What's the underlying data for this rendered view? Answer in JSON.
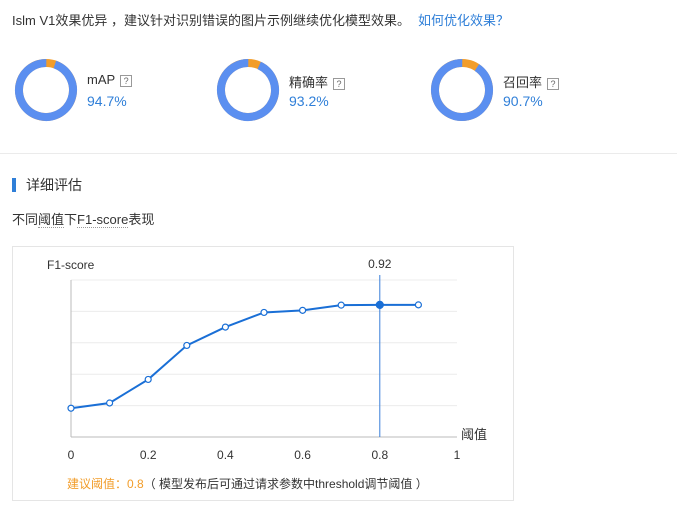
{
  "header": {
    "text": "Islm V1效果优异 ，建议针对识别错误的图片示例继续优化模型效果。",
    "link": "如何优化效果？"
  },
  "metrics": [
    {
      "name": "mAP",
      "value_text": "94.7%",
      "value": 0.947
    },
    {
      "name": "精确率",
      "value_text": "93.2%",
      "value": 0.932
    },
    {
      "name": "召回率",
      "value_text": "90.7%",
      "value": 0.907
    }
  ],
  "help_mark": "?",
  "colors": {
    "ring_main": "#5b8ff0",
    "ring_rest": "#f29d2a",
    "accent": "#2f7fd8",
    "orange": "#f29d2a",
    "line": "#1a6fd6"
  },
  "section": {
    "title": "详细评估"
  },
  "chart_subtitle": {
    "prefix": "不同",
    "mid1": "阈值",
    "mid2": "下",
    "mid3": "F1-score",
    "suffix": "表现"
  },
  "chart_data": {
    "type": "line",
    "ylabel": "F1-score",
    "xlabel": "阈值",
    "x_ticks": [
      "0",
      "0.2",
      "0.4",
      "0.6",
      "0.8",
      "1"
    ],
    "xlim": [
      0,
      1
    ],
    "ylim": [
      0.4,
      1.0
    ],
    "grid": true,
    "x": [
      0,
      0.1,
      0.2,
      0.3,
      0.4,
      0.5,
      0.6,
      0.7,
      0.8,
      0.9
    ],
    "y": [
      0.51,
      0.53,
      0.62,
      0.75,
      0.82,
      0.876,
      0.884,
      0.904,
      0.905,
      0.905
    ],
    "highlight": {
      "x": 0.8,
      "label": "0.92"
    }
  },
  "suggestion": {
    "label": "建议阈值：0.8",
    "note": "（ 模型发布后可通过请求参数中threshold调节阈值 ）"
  }
}
